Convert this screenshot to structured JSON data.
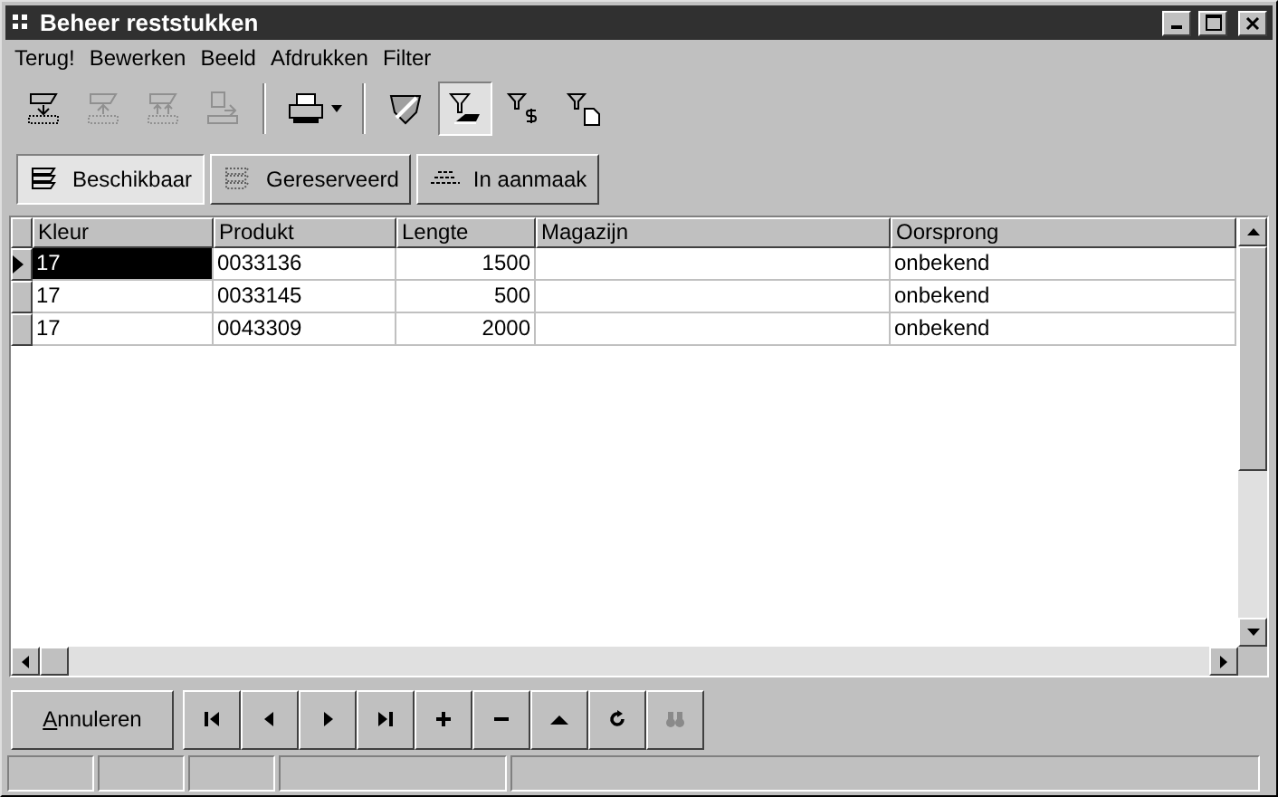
{
  "window": {
    "title": "Beheer reststukken"
  },
  "menu": [
    "Terug!",
    "Bewerken",
    "Beeld",
    "Afdrukken",
    "Filter"
  ],
  "toolbar": [
    {
      "kind": "button",
      "disabled": false,
      "pressed": false
    },
    {
      "kind": "button",
      "disabled": true,
      "pressed": false
    },
    {
      "kind": "button",
      "disabled": true,
      "pressed": false
    },
    {
      "kind": "button",
      "disabled": true,
      "pressed": false
    },
    {
      "kind": "separator"
    },
    {
      "kind": "dropdown",
      "disabled": false,
      "pressed": false
    },
    {
      "kind": "separator"
    },
    {
      "kind": "button",
      "disabled": false,
      "pressed": false
    },
    {
      "kind": "button",
      "disabled": false,
      "pressed": true
    },
    {
      "kind": "button",
      "disabled": false,
      "pressed": false
    },
    {
      "kind": "button",
      "disabled": false,
      "pressed": false
    }
  ],
  "views": [
    {
      "label": "Beschikbaar",
      "selected": true
    },
    {
      "label": "Gereserveerd",
      "selected": false
    },
    {
      "label": "In aanmaak",
      "selected": false
    }
  ],
  "table": {
    "columns": [
      {
        "label": "Kleur",
        "kind": "text"
      },
      {
        "label": "Produkt",
        "kind": "text"
      },
      {
        "label": "Lengte",
        "kind": "number"
      },
      {
        "label": "Magazijn",
        "kind": "text"
      },
      {
        "label": "Oorsprong",
        "kind": "text"
      }
    ],
    "rows": [
      {
        "selected": true,
        "cells": [
          "17",
          "0033136",
          "1500",
          "",
          "onbekend"
        ]
      },
      {
        "selected": false,
        "cells": [
          "17",
          "0033145",
          "500",
          "",
          "onbekend"
        ]
      },
      {
        "selected": false,
        "cells": [
          "17",
          "0043309",
          "2000",
          "",
          "onbekend"
        ]
      }
    ]
  },
  "cancel_button": "Annuleren",
  "navigator": [
    {
      "disabled": false
    },
    {
      "disabled": false
    },
    {
      "disabled": false
    },
    {
      "disabled": false
    },
    {
      "disabled": false
    },
    {
      "disabled": false
    },
    {
      "disabled": false
    },
    {
      "disabled": false
    },
    {
      "disabled": true
    }
  ]
}
